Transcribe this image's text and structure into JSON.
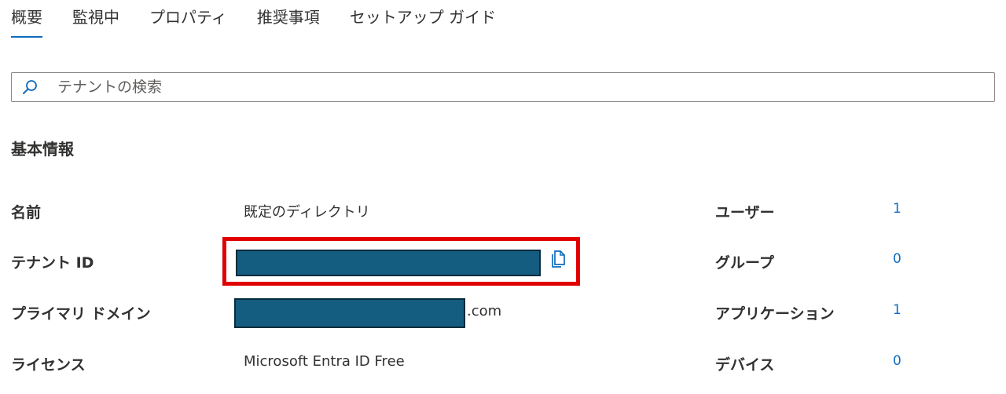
{
  "tabs": [
    {
      "label": "概要",
      "active": true
    },
    {
      "label": "監視中",
      "active": false
    },
    {
      "label": "プロパティ",
      "active": false
    },
    {
      "label": "推奨事項",
      "active": false
    },
    {
      "label": "セットアップ ガイド",
      "active": false
    }
  ],
  "search": {
    "placeholder": "テナントの検索",
    "icon": "search-icon"
  },
  "basic_info": {
    "title": "基本情報",
    "rows": [
      {
        "label": "名前",
        "value": "既定のディレクトリ"
      },
      {
        "label": "テナント ID",
        "value": ""
      },
      {
        "label": "プライマリ ドメイン",
        "value_suffix": ".com"
      },
      {
        "label": "ライセンス",
        "value": "Microsoft Entra ID Free"
      }
    ],
    "stats": [
      {
        "label": "ユーザー",
        "value": "1"
      },
      {
        "label": "グループ",
        "value": "0"
      },
      {
        "label": "アプリケーション",
        "value": "1"
      },
      {
        "label": "デバイス",
        "value": "0"
      }
    ]
  },
  "colors": {
    "accent": "#0f6cbd",
    "highlight": "#e00000",
    "redaction": "#155d80"
  }
}
